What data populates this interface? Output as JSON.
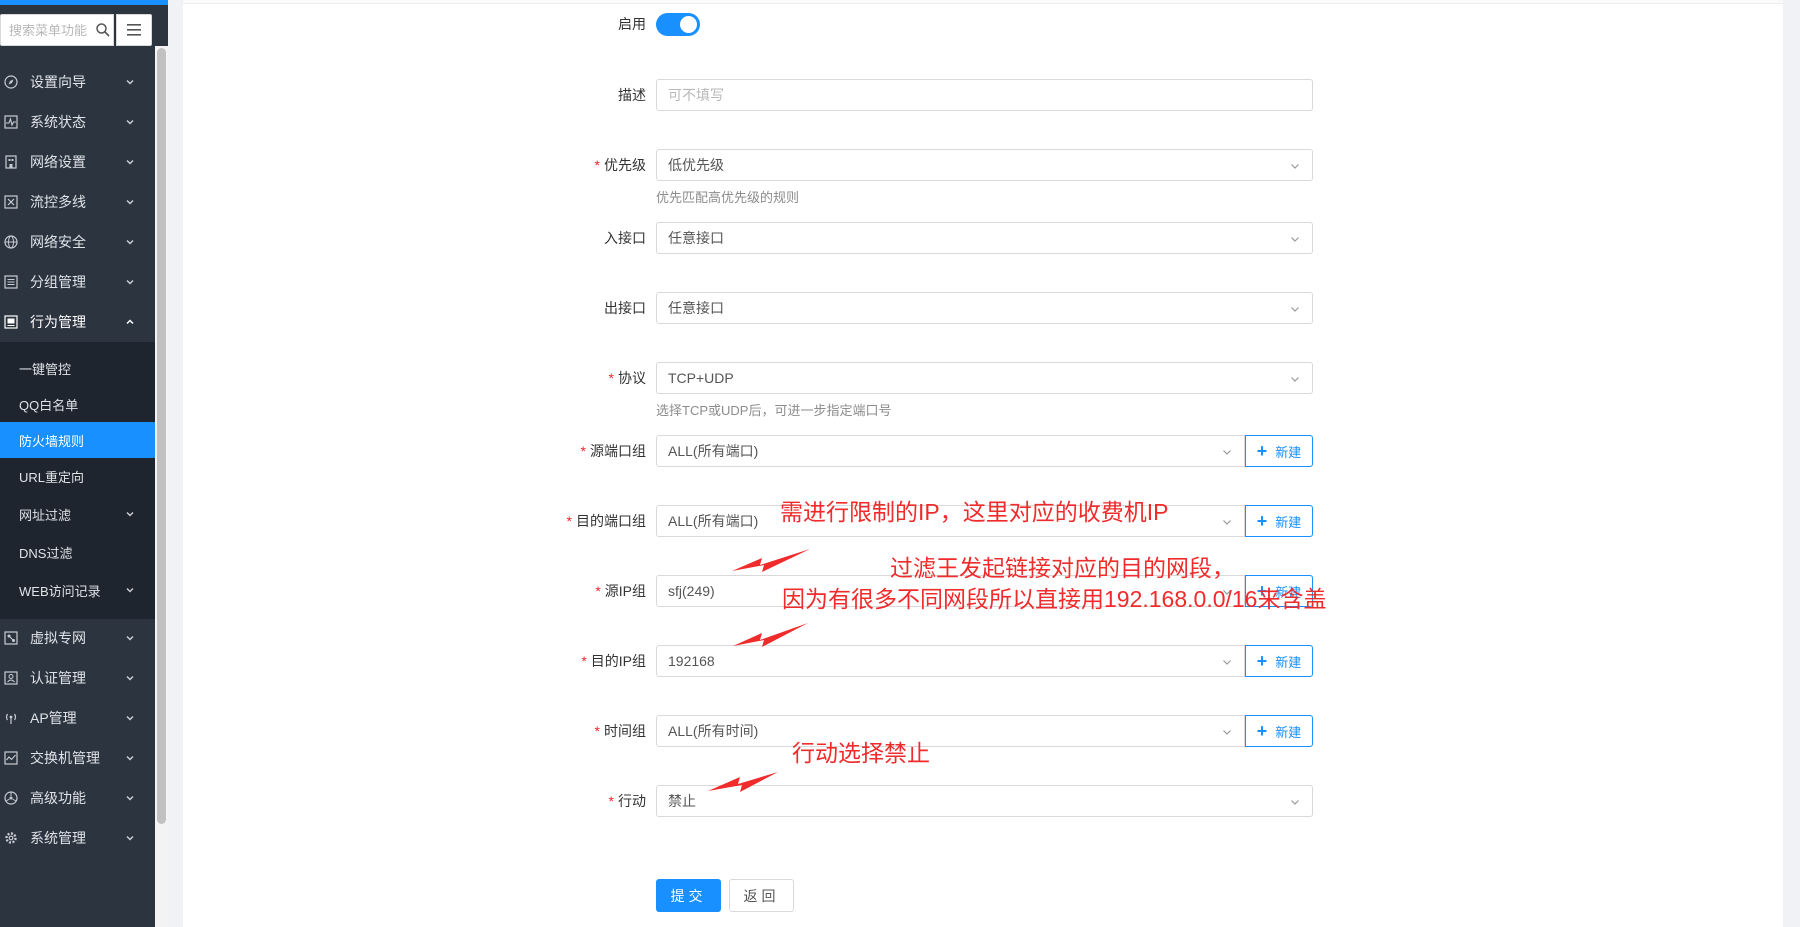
{
  "sidebar": {
    "search_placeholder": "搜索菜单功能",
    "menu": [
      {
        "label": "设置向导",
        "icon": "compass-icon"
      },
      {
        "label": "系统状态",
        "icon": "pulse-chart-icon"
      },
      {
        "label": "网络设置",
        "icon": "building-icon"
      },
      {
        "label": "流控多线",
        "icon": "flow-control-icon"
      },
      {
        "label": "网络安全",
        "icon": "globe-icon"
      },
      {
        "label": "分组管理",
        "icon": "list-icon"
      },
      {
        "label": "行为管理",
        "icon": "monitor-icon"
      }
    ],
    "submenu": [
      {
        "label": "一键管控"
      },
      {
        "label": "QQ白名单"
      },
      {
        "label": "防火墙规则"
      },
      {
        "label": "URL重定向"
      },
      {
        "label": "网址过滤"
      },
      {
        "label": "DNS过滤"
      },
      {
        "label": "WEB访问记录"
      }
    ],
    "menu_after": [
      {
        "label": "虚拟专网",
        "icon": "vpn-icon"
      },
      {
        "label": "认证管理",
        "icon": "auth-icon"
      },
      {
        "label": "AP管理",
        "icon": "wireless-icon"
      },
      {
        "label": "交换机管理",
        "icon": "switch-icon"
      },
      {
        "label": "高级功能",
        "icon": "advanced-icon"
      },
      {
        "label": "系统管理",
        "icon": "gear-icon"
      }
    ]
  },
  "form": {
    "enable": {
      "label": "启用",
      "on": true
    },
    "description": {
      "label": "描述",
      "placeholder": "可不填写"
    },
    "priority": {
      "label": "优先级",
      "value": "低优先级",
      "hint": "优先匹配高优先级的规则"
    },
    "in_interface": {
      "label": "入接口",
      "value": "任意接口"
    },
    "out_interface": {
      "label": "出接口",
      "value": "任意接口"
    },
    "protocol": {
      "label": "协议",
      "value": "TCP+UDP",
      "hint": "选择TCP或UDP后，可进一步指定端口号"
    },
    "src_port_group": {
      "label": "源端口组",
      "value": "ALL(所有端口)"
    },
    "dst_port_group": {
      "label": "目的端口组",
      "value": "ALL(所有端口)"
    },
    "src_ip_group": {
      "label": "源IP组",
      "value": "sfj(249)"
    },
    "dst_ip_group": {
      "label": "目的IP组",
      "value": "192168"
    },
    "time_group": {
      "label": "时间组",
      "value": "ALL(所有时间)"
    },
    "action": {
      "label": "行动",
      "value": "禁止"
    },
    "new_label": "新建",
    "required_mark": "*",
    "submit": "提交",
    "back": "返回"
  },
  "annotations": {
    "note1": "需进行限制的IP，这里对应的收费机IP",
    "note2_line1": "过滤王发起链接对应的目的网段，",
    "note2_line2": "因为有很多不同网段所以直接用192.168.0.0/16来含盖",
    "note3": "行动选择禁止",
    "color": "#ef2b2b"
  },
  "colors": {
    "accent": "#1890ff",
    "sidebar_bg": "#2c3440",
    "submenu_bg": "#1e252e",
    "required": "#f5222d"
  }
}
